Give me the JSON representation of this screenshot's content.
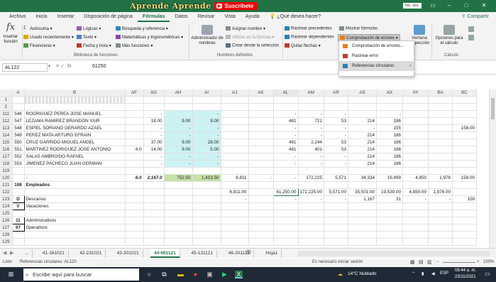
{
  "titlebar": {
    "banner_text": "Aprende Aprende",
    "subscribe": "Suscríbete",
    "yt": "▶",
    "signin": "Inic. ses."
  },
  "menu": {
    "tabs": [
      "Archivo",
      "Inicio",
      "Insertar",
      "Disposición de página",
      "Fórmulas",
      "Datos",
      "Revisar",
      "Vista",
      "Ayuda",
      "¿Qué desea hacer?"
    ],
    "share": "Compartir"
  },
  "ribbon": {
    "insert_function": "Insertar función",
    "lib": {
      "autosuma": "Autosuma",
      "usado": "Usado recientemente",
      "financieras": "Financieras",
      "logicas": "Lógicas",
      "texto": "Texto",
      "fecha": "Fecha y hora",
      "busqueda": "Búsqueda y referencia",
      "matematicas": "Matemáticas y trigonométricas",
      "mas": "Más funciones",
      "label": "Biblioteca de funciones"
    },
    "names": {
      "admin": "Administrador de nombres",
      "asignar": "Asignar nombre",
      "utilizar": "Utilizar en la fórmula",
      "crear": "Crear desde la selección",
      "label": "Nombres definidos"
    },
    "audit": {
      "precedentes": "Rastrear precedentes",
      "dependientes": "Rastrear dependientes",
      "quitar": "Quitar flechas",
      "mostrar": "Mostrar fórmulas",
      "comprobacion": "Comprobación de errores"
    },
    "watch": "Ventana Inspección",
    "calc": {
      "opciones": "Opciones para el cálculo",
      "label": "Cálculo"
    }
  },
  "dropdown": {
    "items": [
      "Comprobación de errores...",
      "Rastrear error",
      "Referencias circulares"
    ]
  },
  "formula_bar": {
    "name_box": "AL122",
    "fx": "fx",
    "value": "61250"
  },
  "columns": [
    "A",
    "B",
    "AF",
    "AG",
    "AH",
    "AI",
    "AJ",
    "AK",
    "AL",
    "AM",
    "AR",
    "AS",
    "AX",
    "AY",
    "BA",
    "BC"
  ],
  "rows": [
    {
      "n": "1",
      "cells": [
        "",
        "",
        "",
        "",
        "",
        "",
        "",
        "",
        "",
        "",
        "",
        "",
        "",
        "",
        "",
        ""
      ]
    },
    {
      "n": "2",
      "cells": [
        "",
        "",
        "",
        "",
        "",
        "",
        "",
        "",
        "",
        "",
        "",
        "",
        "",
        "",
        "",
        ""
      ]
    },
    {
      "n": "111",
      "cells": [
        "546",
        "RODRIGUEZ PEREA JOSE MANUEL",
        "",
        "-",
        "",
        "-",
        "",
        "",
        "-",
        "-",
        "-",
        "",
        "-",
        "",
        "",
        ""
      ]
    },
    {
      "n": "112",
      "cells": [
        "547",
        "LEZAMA RAMIREZ BRANDON YAIR",
        "",
        "18.00",
        "9.00",
        "9.00",
        "",
        "",
        "481",
        "721",
        "53",
        "214",
        "186",
        "",
        "",
        ""
      ]
    },
    {
      "n": "113",
      "cells": [
        "548",
        "ESPIEL SORIANO GERARDO AZAEL",
        "",
        "-",
        "-",
        "-",
        "",
        "",
        "-",
        "-",
        "-",
        "-",
        "155",
        "",
        "",
        "158.00"
      ]
    },
    {
      "n": "114",
      "cells": [
        "549",
        "PEREZ MATA ARTURO EFRAIN",
        "",
        "-",
        "-",
        "-",
        "",
        "",
        "-",
        "-",
        "-",
        "214",
        "186",
        "",
        "",
        ""
      ]
    },
    {
      "n": "115",
      "cells": [
        "550",
        "CRUZ GARRIDO MIGUEL ANGEL",
        "",
        "37.00",
        "9.00",
        "28.00",
        "",
        "",
        "481",
        "2,244",
        "53",
        "214",
        "186",
        "",
        "",
        ""
      ]
    },
    {
      "n": "116",
      "cells": [
        "551",
        "MARTINEZ RODRIGUEZ JOSE ANTONIO",
        "4.0",
        "14.00",
        "9.00",
        "5.00",
        "",
        "",
        "481",
        "401",
        "53",
        "214",
        "186",
        "",
        "",
        ""
      ]
    },
    {
      "n": "117",
      "cells": [
        "552",
        "SALAS AMBROSIO RAFAEL",
        "",
        "-",
        "-",
        "-",
        "",
        "",
        "-",
        "-",
        "-",
        "214",
        "186",
        "",
        "",
        ""
      ]
    },
    {
      "n": "118",
      "cells": [
        "553",
        "JIMENEZ PACHECO JUAN GERMAN",
        "",
        "-",
        "-",
        "-",
        "",
        "",
        "-",
        "-",
        "-",
        "214",
        "186",
        "",
        "",
        ""
      ]
    },
    {
      "n": "119",
      "cells": [
        "",
        "",
        "",
        "",
        "",
        "",
        "",
        "",
        "",
        "",
        "",
        "",
        "",
        "",
        "",
        ""
      ]
    },
    {
      "n": "120",
      "cells": [
        "",
        "-",
        "6.0",
        "2,167.0",
        "752.50",
        "1,413.50",
        "6,811",
        "-",
        "-",
        "172,225",
        "5,571",
        "34,334",
        "19,499",
        "4,850",
        "1,976",
        "158.00"
      ]
    },
    {
      "n": "121",
      "cells": [
        "108",
        "Empleados",
        "",
        "",
        "",
        "",
        "",
        "",
        "",
        "",
        "",
        "",
        "",
        "",
        "",
        ""
      ]
    },
    {
      "n": "122",
      "cells": [
        "",
        "",
        "",
        "",
        "",
        "",
        "6,811.00",
        "",
        "61,250.00",
        "172,225.00",
        "5,571.00",
        "35,501.00",
        "19,530.00",
        "4,850.00",
        "1,976.00",
        ""
      ]
    },
    {
      "n": "123",
      "cells": [
        "D",
        "Descanso",
        "",
        "",
        "",
        "",
        "-",
        "",
        "-",
        "-",
        "-",
        "1,167",
        "31",
        "-",
        "-",
        "158"
      ]
    },
    {
      "n": "124",
      "cells": [
        "V",
        "Vacaciones",
        "",
        "",
        "",
        "",
        "",
        "",
        "",
        "",
        "",
        "",
        "",
        "",
        "",
        ""
      ]
    },
    {
      "n": "125",
      "cells": [
        "",
        "",
        "",
        "",
        "",
        "",
        "",
        "",
        "",
        "",
        "",
        "",
        "",
        "",
        "",
        ""
      ]
    },
    {
      "n": "126",
      "cells": [
        "11",
        "Administrativos",
        "",
        "",
        "",
        "",
        "",
        "",
        "",
        "",
        "",
        "",
        "",
        "",
        "",
        ""
      ]
    },
    {
      "n": "127",
      "cells": [
        "97",
        "Operativos",
        "",
        "",
        "",
        "",
        "",
        "",
        "",
        "",
        "",
        "",
        "",
        "",
        "",
        ""
      ]
    },
    {
      "n": "128",
      "cells": [
        "",
        "",
        "",
        "",
        "",
        "",
        "",
        "",
        "",
        "",
        "",
        "",
        "",
        "",
        "",
        ""
      ]
    },
    {
      "n": "129",
      "cells": [
        "",
        "",
        "",
        "",
        "",
        "",
        "",
        "",
        "",
        "",
        "",
        "",
        "",
        "",
        "",
        ""
      ]
    }
  ],
  "sheets": [
    "...",
    "41-161021",
    "42-231021",
    "43-301021",
    "44-061121",
    "45-131121",
    "46-201121",
    "Hoja1"
  ],
  "active_sheet": "44-061121",
  "status": {
    "mode": "Listo",
    "circular": "Referencias circulares: AL120",
    "notice": "Es necesario iniciar sesión",
    "zoom": "100%"
  },
  "taskbar": {
    "search": "Escribe aquí para buscar",
    "weather": "14°C Nublado",
    "time": "08:44 a. m.",
    "date": "23/11/2021",
    "lang": "ESP"
  }
}
